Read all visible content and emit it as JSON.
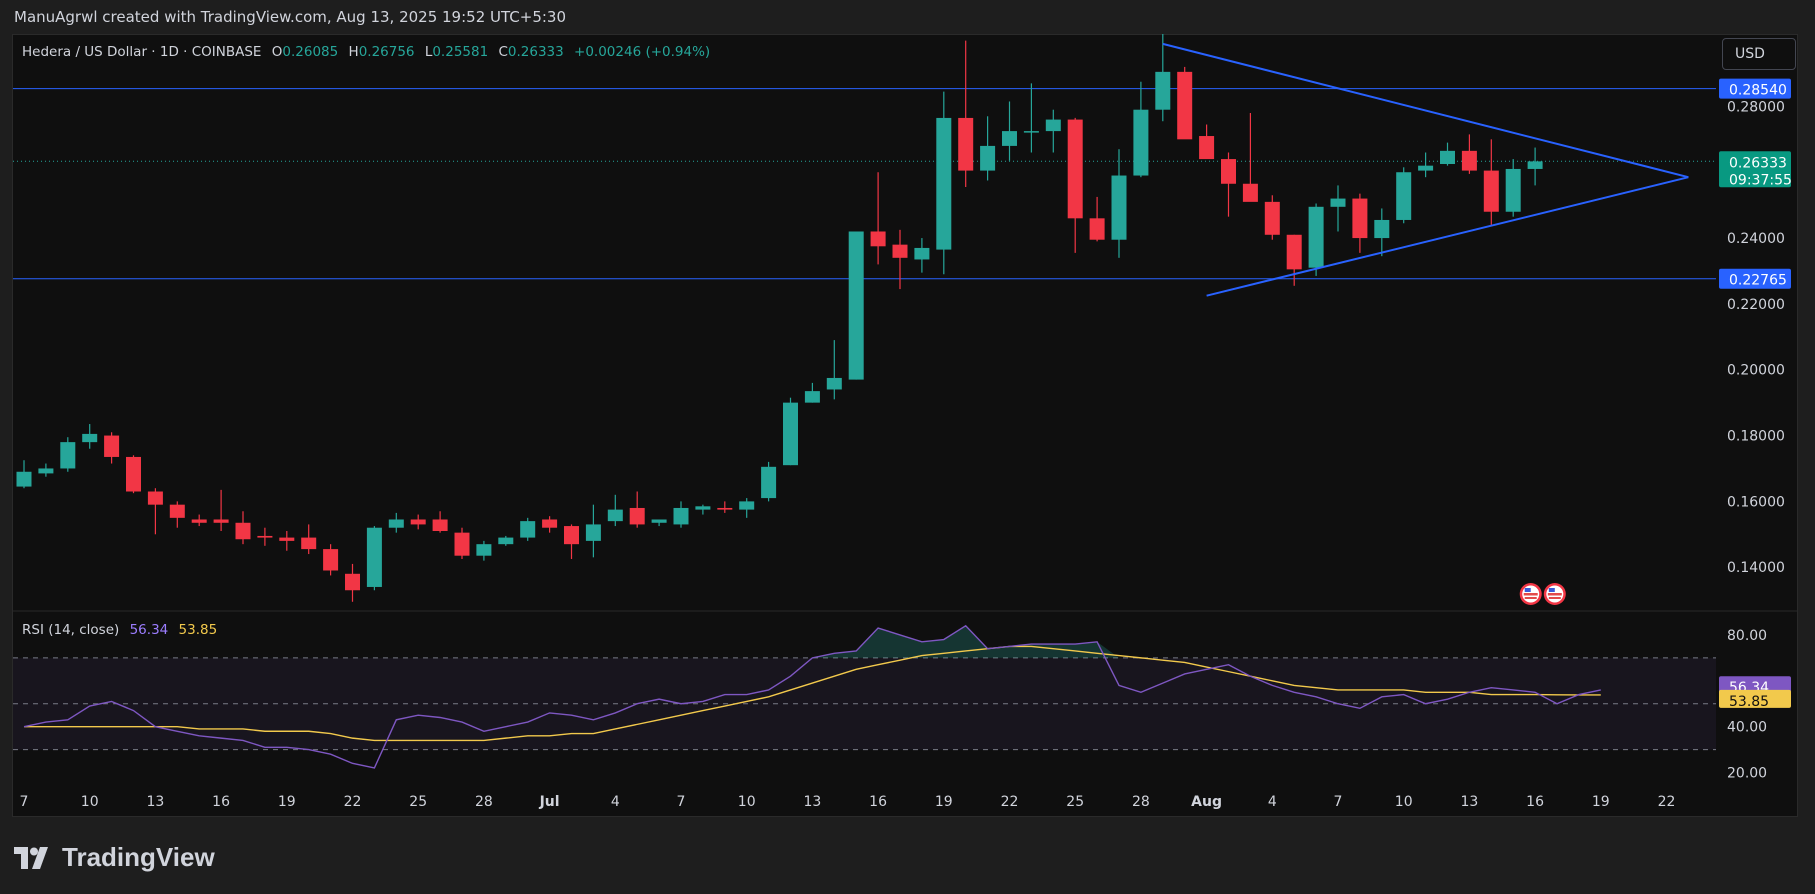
{
  "header": {
    "attribution": "ManuAgrwl created with TradingView.com, Aug 13, 2025 19:52 UTC+5:30"
  },
  "legend": {
    "symbol": "Hedera / US Dollar · 1D · COINBASE",
    "o_label": "O",
    "o": "0.26085",
    "h_label": "H",
    "h": "0.26756",
    "l_label": "L",
    "l": "0.25581",
    "c_label": "C",
    "c": "0.26333",
    "change": "+0.00246 (+0.94%)"
  },
  "rsi_legend": {
    "label": "RSI (14, close)",
    "rsi": "56.34",
    "ma": "53.85"
  },
  "currency_button": "USD",
  "footer": {
    "brand": "TradingView"
  },
  "colors": {
    "up": "#26a69a",
    "down": "#f23645",
    "level": "#2962ff",
    "rsi": "#7e57c2",
    "rsi_ma": "#f2c94c"
  },
  "chart_data": [
    {
      "type": "candlestick",
      "title": "Hedera / US Dollar · 1D · COINBASE",
      "ylim": [
        0.127,
        0.302
      ],
      "y_ticks": [
        "0.28000",
        "0.24000",
        "0.22000",
        "0.20000",
        "0.18000",
        "0.16000",
        "0.14000"
      ],
      "y_tick_values": [
        0.28,
        0.24,
        0.22,
        0.2,
        0.18,
        0.16,
        0.14
      ],
      "x_ticks": [
        "7",
        "10",
        "13",
        "16",
        "19",
        "22",
        "25",
        "28",
        "Jul",
        "4",
        "7",
        "10",
        "13",
        "16",
        "19",
        "22",
        "25",
        "28",
        "Aug",
        "4",
        "7",
        "10",
        "13",
        "16",
        "19",
        "22"
      ],
      "x_tick_index": [
        0,
        3,
        6,
        9,
        12,
        15,
        18,
        21,
        24,
        27,
        30,
        33,
        36,
        39,
        42,
        45,
        48,
        51,
        54,
        57,
        60,
        63,
        66,
        69,
        72,
        75
      ],
      "candles": [
        {
          "o": 0.1645,
          "h": 0.1725,
          "l": 0.164,
          "c": 0.169
        },
        {
          "o": 0.1685,
          "h": 0.1715,
          "l": 0.1675,
          "c": 0.17
        },
        {
          "o": 0.17,
          "h": 0.1795,
          "l": 0.169,
          "c": 0.178
        },
        {
          "o": 0.178,
          "h": 0.1835,
          "l": 0.176,
          "c": 0.1805
        },
        {
          "o": 0.18,
          "h": 0.181,
          "l": 0.1715,
          "c": 0.1735
        },
        {
          "o": 0.1735,
          "h": 0.174,
          "l": 0.1625,
          "c": 0.163
        },
        {
          "o": 0.163,
          "h": 0.164,
          "l": 0.15,
          "c": 0.159
        },
        {
          "o": 0.159,
          "h": 0.16,
          "l": 0.152,
          "c": 0.155
        },
        {
          "o": 0.1545,
          "h": 0.156,
          "l": 0.1525,
          "c": 0.1535
        },
        {
          "o": 0.1545,
          "h": 0.1635,
          "l": 0.151,
          "c": 0.1535
        },
        {
          "o": 0.1535,
          "h": 0.157,
          "l": 0.147,
          "c": 0.1485
        },
        {
          "o": 0.1495,
          "h": 0.152,
          "l": 0.1465,
          "c": 0.149
        },
        {
          "o": 0.149,
          "h": 0.151,
          "l": 0.145,
          "c": 0.148
        },
        {
          "o": 0.149,
          "h": 0.153,
          "l": 0.144,
          "c": 0.1455
        },
        {
          "o": 0.1455,
          "h": 0.147,
          "l": 0.1375,
          "c": 0.139
        },
        {
          "o": 0.138,
          "h": 0.141,
          "l": 0.1295,
          "c": 0.133
        },
        {
          "o": 0.134,
          "h": 0.1525,
          "l": 0.133,
          "c": 0.152
        },
        {
          "o": 0.152,
          "h": 0.1565,
          "l": 0.1505,
          "c": 0.1545
        },
        {
          "o": 0.1545,
          "h": 0.156,
          "l": 0.1515,
          "c": 0.153
        },
        {
          "o": 0.1545,
          "h": 0.157,
          "l": 0.1505,
          "c": 0.151
        },
        {
          "o": 0.1505,
          "h": 0.152,
          "l": 0.1425,
          "c": 0.1435
        },
        {
          "o": 0.1435,
          "h": 0.148,
          "l": 0.142,
          "c": 0.147
        },
        {
          "o": 0.147,
          "h": 0.1495,
          "l": 0.1465,
          "c": 0.149
        },
        {
          "o": 0.149,
          "h": 0.155,
          "l": 0.148,
          "c": 0.154
        },
        {
          "o": 0.1545,
          "h": 0.1555,
          "l": 0.1505,
          "c": 0.152
        },
        {
          "o": 0.1525,
          "h": 0.153,
          "l": 0.1425,
          "c": 0.147
        },
        {
          "o": 0.148,
          "h": 0.159,
          "l": 0.143,
          "c": 0.153
        },
        {
          "o": 0.154,
          "h": 0.162,
          "l": 0.1525,
          "c": 0.1575
        },
        {
          "o": 0.158,
          "h": 0.163,
          "l": 0.152,
          "c": 0.153
        },
        {
          "o": 0.1535,
          "h": 0.1545,
          "l": 0.1525,
          "c": 0.1545
        },
        {
          "o": 0.153,
          "h": 0.16,
          "l": 0.152,
          "c": 0.158
        },
        {
          "o": 0.1575,
          "h": 0.159,
          "l": 0.156,
          "c": 0.1585
        },
        {
          "o": 0.158,
          "h": 0.16,
          "l": 0.1565,
          "c": 0.1575
        },
        {
          "o": 0.1575,
          "h": 0.161,
          "l": 0.155,
          "c": 0.16
        },
        {
          "o": 0.161,
          "h": 0.172,
          "l": 0.16,
          "c": 0.1705
        },
        {
          "o": 0.171,
          "h": 0.1915,
          "l": 0.171,
          "c": 0.19
        },
        {
          "o": 0.19,
          "h": 0.196,
          "l": 0.19,
          "c": 0.1935
        },
        {
          "o": 0.194,
          "h": 0.209,
          "l": 0.191,
          "c": 0.1975
        },
        {
          "o": 0.197,
          "h": 0.2105,
          "l": 0.197,
          "c": 0.242
        },
        {
          "o": 0.242,
          "h": 0.26,
          "l": 0.232,
          "c": 0.2375
        },
        {
          "o": 0.238,
          "h": 0.2425,
          "l": 0.2245,
          "c": 0.234
        },
        {
          "o": 0.2335,
          "h": 0.24,
          "l": 0.2295,
          "c": 0.237
        },
        {
          "o": 0.2365,
          "h": 0.2845,
          "l": 0.229,
          "c": 0.2765
        },
        {
          "o": 0.2765,
          "h": 0.3,
          "l": 0.2555,
          "c": 0.2605
        },
        {
          "o": 0.2605,
          "h": 0.277,
          "l": 0.2575,
          "c": 0.268
        },
        {
          "o": 0.268,
          "h": 0.2815,
          "l": 0.2635,
          "c": 0.2725
        },
        {
          "o": 0.2725,
          "h": 0.287,
          "l": 0.266,
          "c": 0.2725
        },
        {
          "o": 0.2725,
          "h": 0.279,
          "l": 0.266,
          "c": 0.276
        },
        {
          "o": 0.276,
          "h": 0.2765,
          "l": 0.2355,
          "c": 0.246
        },
        {
          "o": 0.246,
          "h": 0.2525,
          "l": 0.239,
          "c": 0.2395
        },
        {
          "o": 0.2395,
          "h": 0.267,
          "l": 0.234,
          "c": 0.259
        },
        {
          "o": 0.259,
          "h": 0.2875,
          "l": 0.2585,
          "c": 0.279
        },
        {
          "o": 0.279,
          "h": 0.302,
          "l": 0.2755,
          "c": 0.2905
        },
        {
          "o": 0.2905,
          "h": 0.292,
          "l": 0.2745,
          "c": 0.27
        },
        {
          "o": 0.271,
          "h": 0.2745,
          "l": 0.265,
          "c": 0.264
        },
        {
          "o": 0.264,
          "h": 0.266,
          "l": 0.2465,
          "c": 0.2565
        },
        {
          "o": 0.2565,
          "h": 0.278,
          "l": 0.253,
          "c": 0.251
        },
        {
          "o": 0.251,
          "h": 0.253,
          "l": 0.2395,
          "c": 0.241
        },
        {
          "o": 0.241,
          "h": 0.241,
          "l": 0.2255,
          "c": 0.2305
        },
        {
          "o": 0.231,
          "h": 0.2505,
          "l": 0.2285,
          "c": 0.2495
        },
        {
          "o": 0.2495,
          "h": 0.256,
          "l": 0.242,
          "c": 0.252
        },
        {
          "o": 0.252,
          "h": 0.2535,
          "l": 0.2355,
          "c": 0.24
        },
        {
          "o": 0.24,
          "h": 0.249,
          "l": 0.2345,
          "c": 0.2455
        },
        {
          "o": 0.2455,
          "h": 0.2615,
          "l": 0.2445,
          "c": 0.26
        },
        {
          "o": 0.2605,
          "h": 0.266,
          "l": 0.2585,
          "c": 0.262
        },
        {
          "o": 0.2625,
          "h": 0.269,
          "l": 0.262,
          "c": 0.2665
        },
        {
          "o": 0.2665,
          "h": 0.2715,
          "l": 0.2595,
          "c": 0.2605
        },
        {
          "o": 0.2605,
          "h": 0.27,
          "l": 0.244,
          "c": 0.248
        },
        {
          "o": 0.248,
          "h": 0.264,
          "l": 0.2465,
          "c": 0.261
        },
        {
          "o": 0.261,
          "h": 0.2675,
          "l": 0.256,
          "c": 0.2633
        }
      ],
      "levels": [
        {
          "value": 0.2854,
          "label": "0.28540"
        },
        {
          "value": 0.22765,
          "label": "0.22765"
        }
      ],
      "last_price": {
        "value": 0.26333,
        "label": "0.26333",
        "countdown": "09:37:55"
      },
      "triangle": {
        "upper": [
          {
            "i": 52,
            "v": 0.299
          },
          {
            "i": 76,
            "v": 0.2585
          }
        ],
        "lower": [
          {
            "i": 54,
            "v": 0.2225
          },
          {
            "i": 76,
            "v": 0.2585
          }
        ]
      },
      "event_markers_index": [
        68.8,
        69.9
      ]
    },
    {
      "type": "line",
      "title": "RSI (14, close)",
      "ylim": [
        15,
        90
      ],
      "y_ticks": [
        "80.00",
        "40.00",
        "20.00"
      ],
      "y_tick_values": [
        80,
        40,
        20
      ],
      "bands": {
        "upper": 70,
        "middle": 50,
        "lower": 30
      },
      "series": [
        {
          "name": "RSI",
          "values": [
            40,
            42,
            43,
            49,
            51,
            47,
            40,
            38,
            36,
            35,
            34,
            31,
            31,
            30,
            28,
            24,
            22,
            43,
            45,
            44,
            42,
            38,
            40,
            42,
            46,
            45,
            43,
            46,
            50,
            52,
            50,
            51,
            54,
            54,
            56,
            62,
            70,
            72,
            73,
            83,
            80,
            77,
            78,
            84,
            74,
            75,
            76,
            76,
            76,
            77,
            58,
            55,
            59,
            63,
            65,
            67,
            62,
            58,
            55,
            53,
            50,
            48,
            53,
            54,
            50,
            52,
            55,
            57,
            56,
            55,
            50,
            54,
            56
          ]
        },
        {
          "name": "RSI MA",
          "values": [
            40,
            40,
            40,
            40,
            40,
            40,
            40,
            40,
            39,
            39,
            39,
            38,
            38,
            38,
            37,
            35,
            34,
            34,
            34,
            34,
            34,
            34,
            35,
            36,
            36,
            37,
            37,
            39,
            41,
            43,
            45,
            47,
            49,
            51,
            53,
            56,
            59,
            62,
            65,
            67,
            69,
            71,
            72,
            73,
            74,
            75,
            75,
            74,
            73,
            72,
            71,
            70,
            69,
            68,
            66,
            64,
            62,
            60,
            58,
            57,
            56,
            56,
            56,
            56,
            55,
            55,
            55,
            54,
            54,
            54,
            53.9,
            53.85,
            53.85
          ]
        }
      ],
      "last_labels": [
        {
          "value": 56.34,
          "label": "56.34"
        },
        {
          "value": 53.85,
          "label": "53.85"
        }
      ]
    }
  ]
}
